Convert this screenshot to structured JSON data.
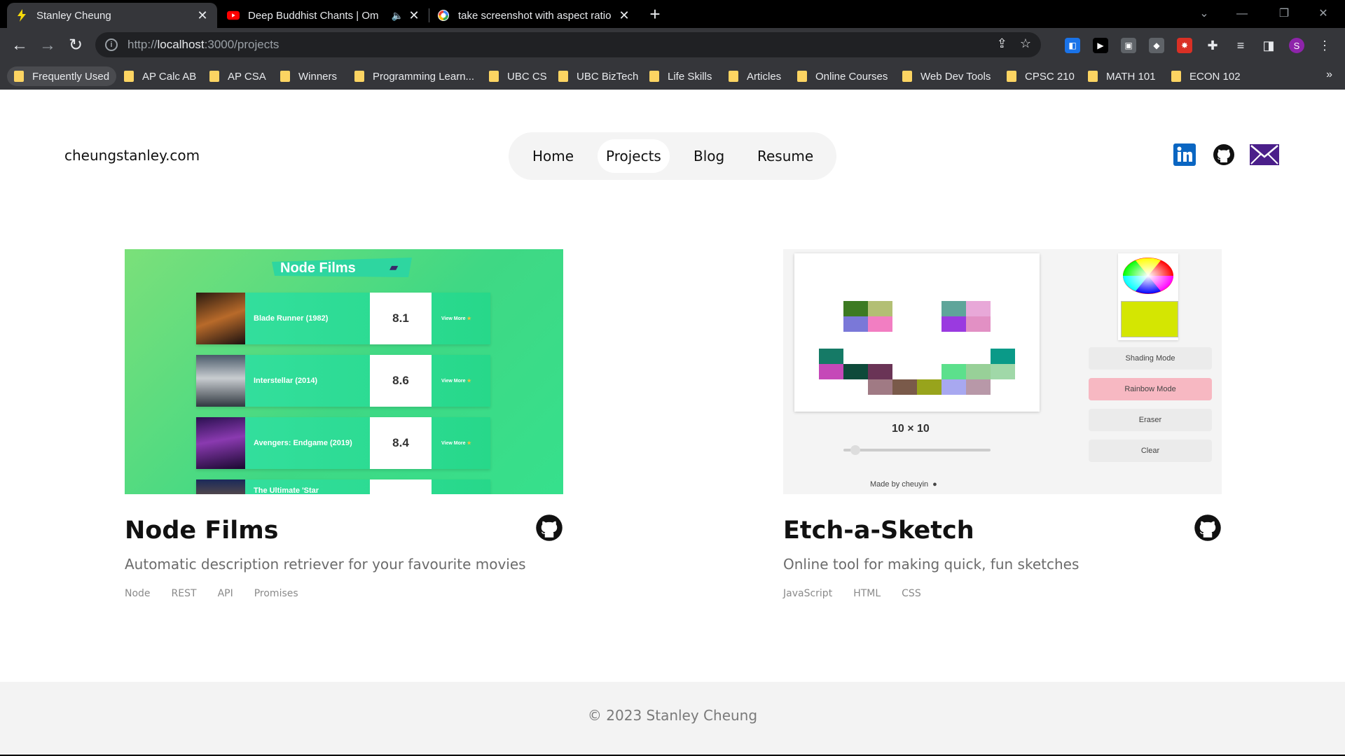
{
  "browser": {
    "tabs": [
      {
        "title": "Stanley Cheung",
        "icon": "lightning-favicon"
      },
      {
        "title": "Deep Buddhist Chants | Om",
        "icon": "youtube-favicon"
      },
      {
        "title": "take screenshot with aspect ratio",
        "icon": "google-favicon"
      }
    ],
    "new_tab": "+",
    "url_scheme": "http://",
    "url_host": "localhost",
    "url_path": ":3000/projects",
    "bookmarks": [
      "Frequently Used",
      "AP Calc AB",
      "AP CSA",
      "Winners",
      "Programming Learn...",
      "UBC CS",
      "UBC BizTech",
      "Life Skills",
      "Articles",
      "Online Courses",
      "Web Dev Tools",
      "CPSC 210",
      "MATH 101",
      "ECON 102"
    ],
    "profile_initial": "S"
  },
  "site": {
    "brand": "cheungstanley.com",
    "nav": [
      "Home",
      "Projects",
      "Blog",
      "Resume"
    ],
    "active_nav": "Projects"
  },
  "projects": [
    {
      "title": "Node Films",
      "description": "Automatic description retriever for your favourite movies",
      "tags": [
        "Node",
        "REST",
        "API",
        "Promises"
      ],
      "thumb": {
        "heading": "Node Films",
        "movies": [
          {
            "name": "Blade Runner (1982)",
            "score": "8.1",
            "more": "View More"
          },
          {
            "name": "Interstellar (2014)",
            "score": "8.6",
            "more": "View More"
          },
          {
            "name": "Avengers: Endgame (2019)",
            "score": "8.4",
            "more": "View More"
          },
          {
            "name": "The Ultimate 'Star",
            "score": "",
            "more": ""
          }
        ]
      }
    },
    {
      "title": "Etch-a-Sketch",
      "description": "Online tool for making quick, fun sketches",
      "tags": [
        "JavaScript",
        "HTML",
        "CSS"
      ],
      "thumb": {
        "grid_size": "10 × 10",
        "made_by": "Made by cheuyin",
        "buttons": [
          "Shading Mode",
          "Rainbow Mode",
          "Eraser",
          "Clear"
        ]
      }
    }
  ],
  "footer": {
    "copyright": "© 2023 Stanley Cheung"
  },
  "colors": {
    "linkedin": "#0a66c2",
    "mail": "#4b1f8a",
    "rainbow_button": "#f7b8c2",
    "swatch": "#d4e602"
  }
}
